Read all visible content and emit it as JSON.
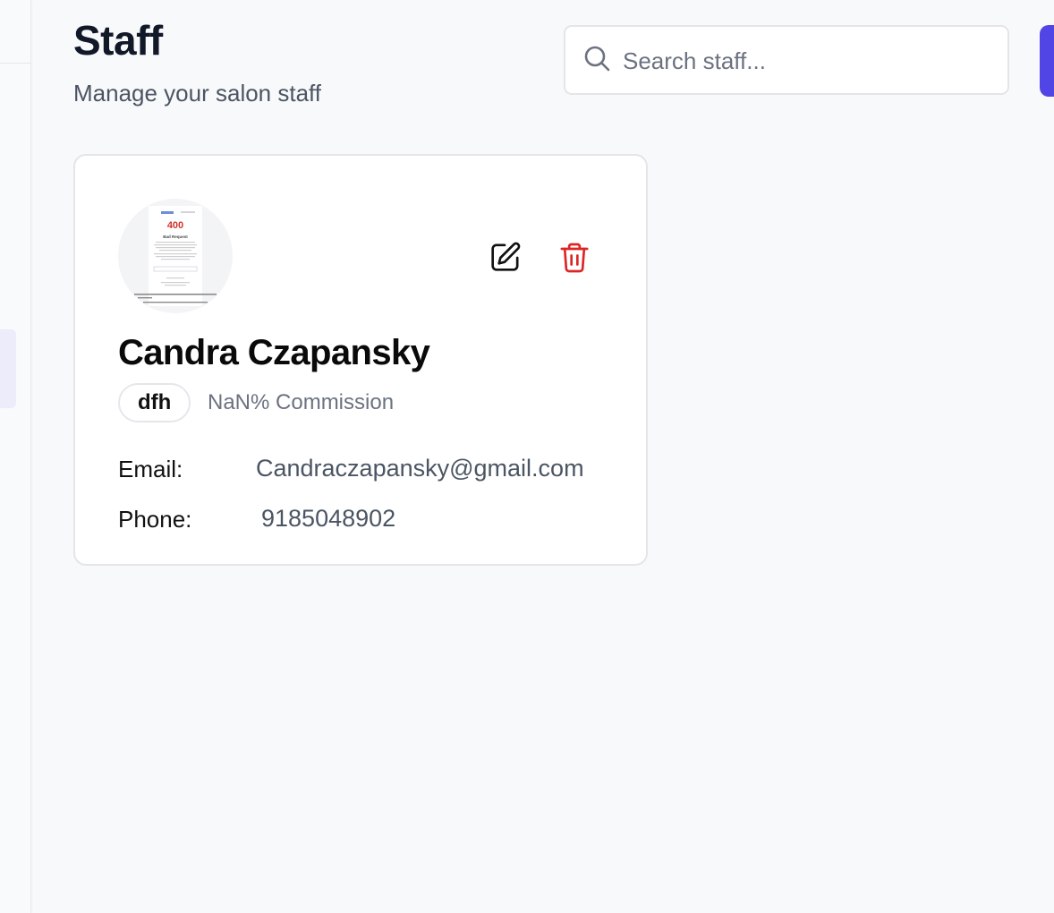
{
  "header": {
    "title": "Staff",
    "subtitle": "Manage your salon staff"
  },
  "search": {
    "placeholder": "Search staff...",
    "value": "",
    "icon": "search-icon"
  },
  "staff": [
    {
      "name": "Candra Czapansky",
      "role": "dfh",
      "commission": "NaN% Commission",
      "email_label": "Email:",
      "email": "Candraczapansky@gmail.com",
      "phone_label": "Phone:",
      "phone": "9185048902",
      "avatar_preview": {
        "code": "400",
        "heading": "Bad Request"
      }
    }
  ],
  "icons": {
    "edit": "edit-icon",
    "delete": "trash-icon"
  },
  "colors": {
    "accent": "#5146e5",
    "danger": "#dc2626",
    "background": "#f8f9fb",
    "card": "#ffffff"
  }
}
